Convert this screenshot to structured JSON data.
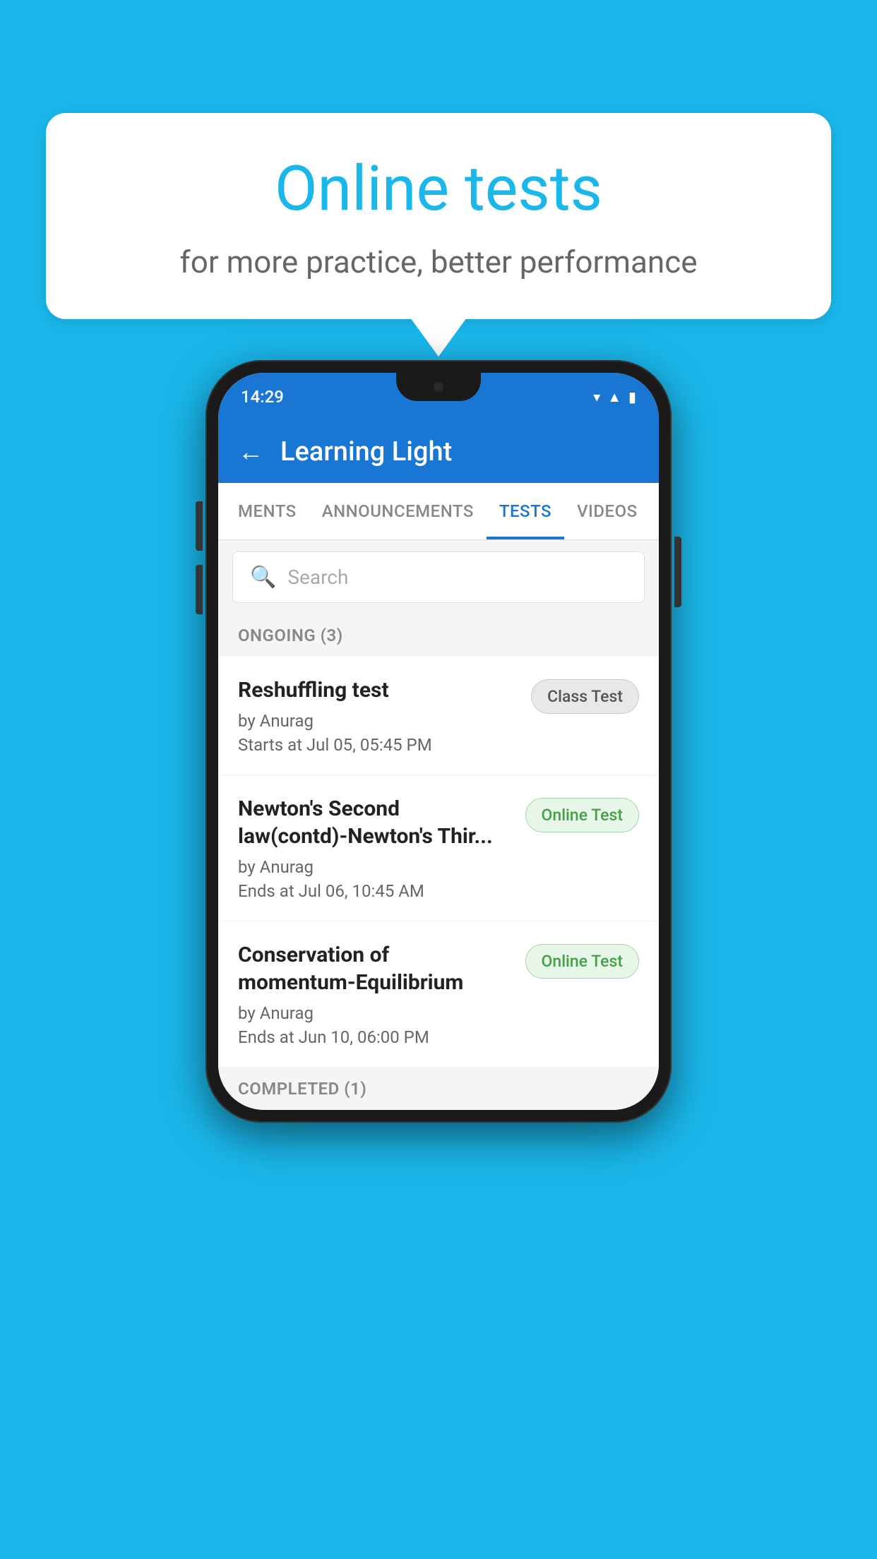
{
  "background_color": "#1ab7ea",
  "speech_bubble": {
    "title": "Online tests",
    "subtitle": "for more practice, better performance"
  },
  "phone": {
    "status_bar": {
      "time": "14:29",
      "icons": [
        "wifi",
        "signal",
        "battery"
      ]
    },
    "app_header": {
      "title": "Learning Light",
      "back_label": "←"
    },
    "tabs": [
      {
        "label": "MENTS",
        "active": false
      },
      {
        "label": "ANNOUNCEMENTS",
        "active": false
      },
      {
        "label": "TESTS",
        "active": true
      },
      {
        "label": "VIDEOS",
        "active": false
      }
    ],
    "search": {
      "placeholder": "Search"
    },
    "sections": [
      {
        "label": "ONGOING (3)",
        "items": [
          {
            "name": "Reshuffling test",
            "author": "by Anurag",
            "date": "Starts at  Jul 05, 05:45 PM",
            "badge": "Class Test",
            "badge_type": "class"
          },
          {
            "name": "Newton's Second law(contd)-Newton's Thir...",
            "author": "by Anurag",
            "date": "Ends at  Jul 06, 10:45 AM",
            "badge": "Online Test",
            "badge_type": "online"
          },
          {
            "name": "Conservation of momentum-Equilibrium",
            "author": "by Anurag",
            "date": "Ends at  Jun 10, 06:00 PM",
            "badge": "Online Test",
            "badge_type": "online"
          }
        ]
      },
      {
        "label": "COMPLETED (1)",
        "items": []
      }
    ]
  }
}
